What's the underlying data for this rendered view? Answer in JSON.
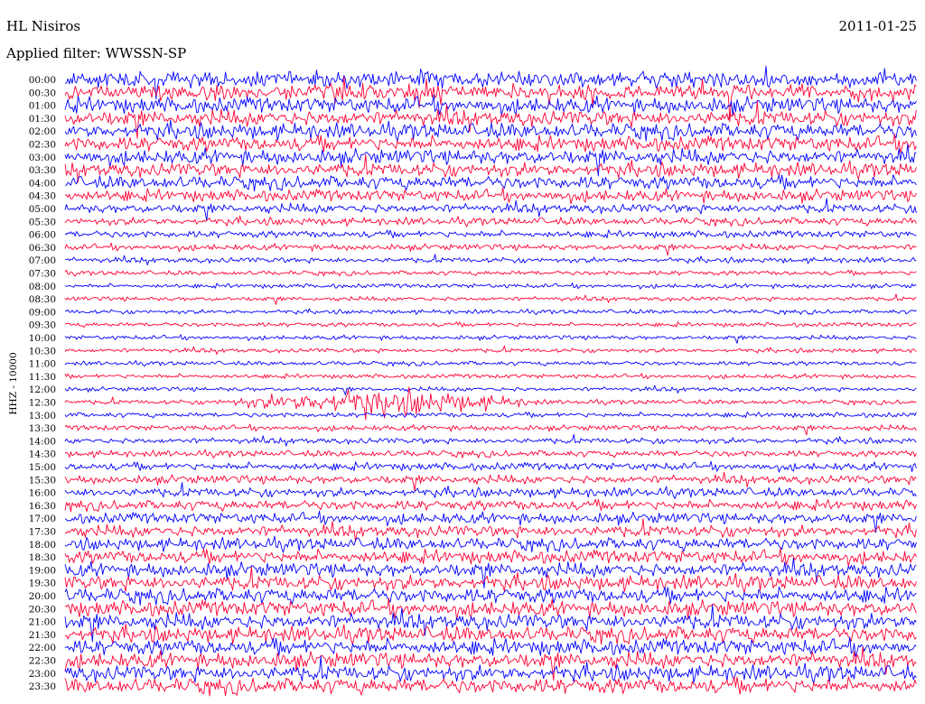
{
  "header": {
    "station": "HL Nisiros",
    "date": "2011-01-25",
    "filter": "Applied filter: WWSSN-SP"
  },
  "colors": {
    "blue_trace": "#0000ff",
    "red_trace": "#ff0033",
    "background": "#ffffff"
  },
  "chart_data": {
    "type": "line",
    "title": "HL Nisiros",
    "ylabel": "HHZ - 10000",
    "xlabel": "",
    "rows": [
      "00:00",
      "00:30",
      "01:00",
      "01:30",
      "02:00",
      "02:30",
      "03:00",
      "03:30",
      "04:00",
      "04:30",
      "05:00",
      "05:30",
      "06:00",
      "06:30",
      "07:00",
      "07:30",
      "08:00",
      "08:30",
      "09:00",
      "09:30",
      "10:00",
      "10:30",
      "11:00",
      "11:30",
      "12:00",
      "12:30",
      "13:00",
      "13:30",
      "14:00",
      "14:30",
      "15:00",
      "15:30",
      "16:00",
      "16:30",
      "17:00",
      "17:30",
      "18:00",
      "18:30",
      "19:00",
      "19:30",
      "20:00",
      "20:30",
      "21:00",
      "21:30",
      "22:00",
      "22:30",
      "23:00",
      "23:30"
    ],
    "row_colors": [
      "blue",
      "red"
    ],
    "row_noise_amplitude": [
      1.0,
      1.0,
      1.0,
      1.0,
      1.0,
      0.95,
      0.95,
      0.9,
      0.85,
      0.75,
      0.6,
      0.5,
      0.45,
      0.4,
      0.35,
      0.3,
      0.28,
      0.28,
      0.28,
      0.28,
      0.28,
      0.28,
      0.28,
      0.28,
      0.28,
      0.3,
      0.32,
      0.35,
      0.38,
      0.42,
      0.5,
      0.55,
      0.6,
      0.65,
      0.7,
      0.75,
      0.8,
      0.85,
      0.9,
      0.95,
      0.95,
      1.0,
      1.0,
      1.0,
      1.0,
      1.0,
      1.0,
      1.0
    ],
    "events": [
      {
        "row": "12:30",
        "start_min": 5.0,
        "end_min": 17.0,
        "peak_min": 11.0,
        "amplitude": 4.0
      }
    ],
    "x_range_minutes": [
      0,
      30
    ],
    "grid": false,
    "legend": "none"
  }
}
